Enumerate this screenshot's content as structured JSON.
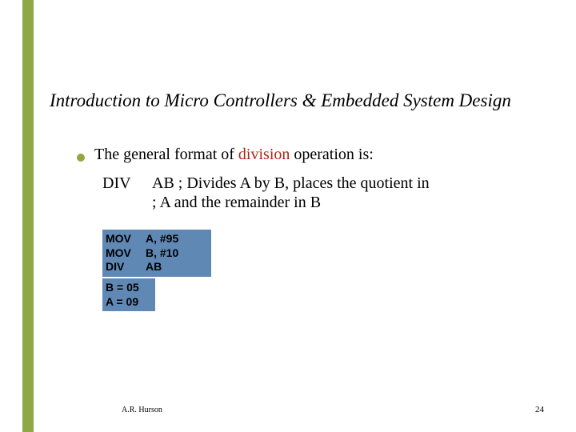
{
  "title": "Introduction to Micro Controllers & Embedded System Design",
  "bullet": {
    "pre": "The general format of ",
    "hl": "division",
    "post": " operation is:"
  },
  "div": {
    "op": "DIV",
    "line1": "AB ; Divides A by B, places the quotient in",
    "line2": "; A and the remainder in B"
  },
  "code1": {
    "r1m": "MOV",
    "r1a": "A, #95",
    "r2m": "MOV",
    "r2a": "B, #10",
    "r3m": "DIV",
    "r3a": "AB"
  },
  "code2": {
    "l1": "B = 05",
    "l2": "A = 09"
  },
  "author": "A.R. Hurson",
  "page": "24"
}
